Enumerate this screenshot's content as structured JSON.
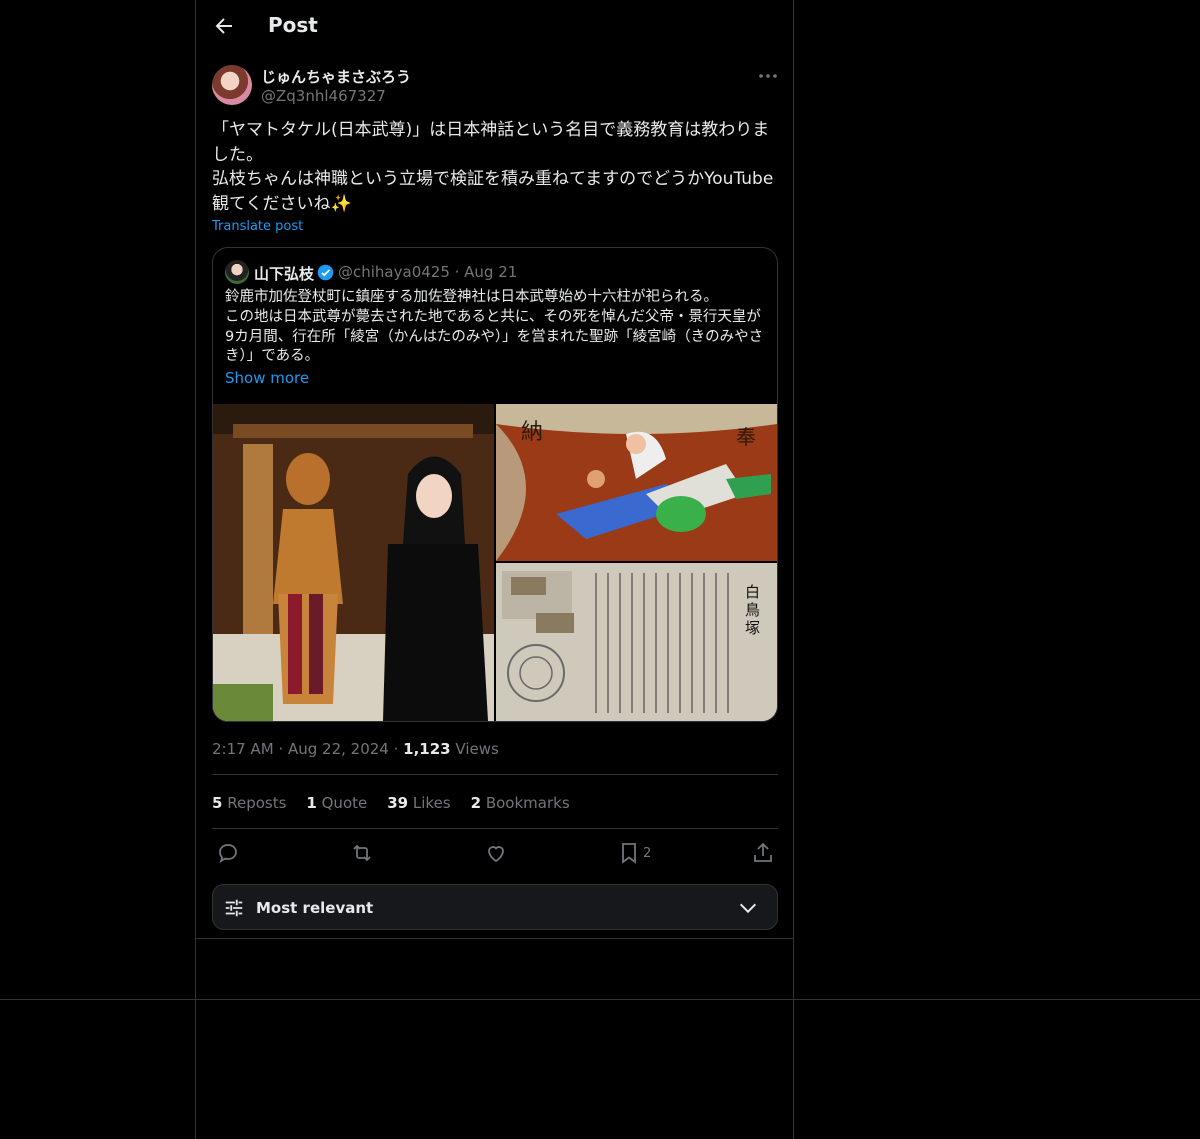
{
  "header": {
    "title": "Post"
  },
  "post": {
    "author_name": "じゅんちゃまさぶろう",
    "author_handle": "@Zq3nhl467327",
    "text": "「ヤマトタケル(日本武尊)」は日本神話という名目で義務教育は教わりました。\n弘枝ちゃんは神職という立場で検証を積み重ねてますのでどうかYouTube観てくださいね✨",
    "translate_label": "Translate post",
    "time": "2:17 AM",
    "date": "Aug 22, 2024",
    "views_count": "1,123",
    "views_label": "Views"
  },
  "quote": {
    "author_name": "山下弘枝",
    "meta": "@chihaya0425 · Aug 21",
    "text": "鈴鹿市加佐登杖町に鎮座する加佐登神社は日本武尊始め十六柱が祀られる。\nこの地は日本武尊が薨去された地であると共に、その死を悼んだ父帝・景行天皇が9カ月間、行在所「綾宮（かんはたのみや）」を営まれた聖跡「綾宮崎（きのみやさき）」である。",
    "show_more": "Show more"
  },
  "stats": {
    "reposts_count": "5",
    "reposts_label": "Reposts",
    "quotes_count": "1",
    "quotes_label": "Quote",
    "likes_count": "39",
    "likes_label": "Likes",
    "bookmarks_count": "2",
    "bookmarks_label": "Bookmarks"
  },
  "actions": {
    "bookmark_count": "2"
  },
  "sort": {
    "label": "Most relevant"
  },
  "colors": {
    "accent": "#1d9bf0",
    "background": "#000000",
    "border": "#2f3336",
    "muted": "#71767b"
  }
}
